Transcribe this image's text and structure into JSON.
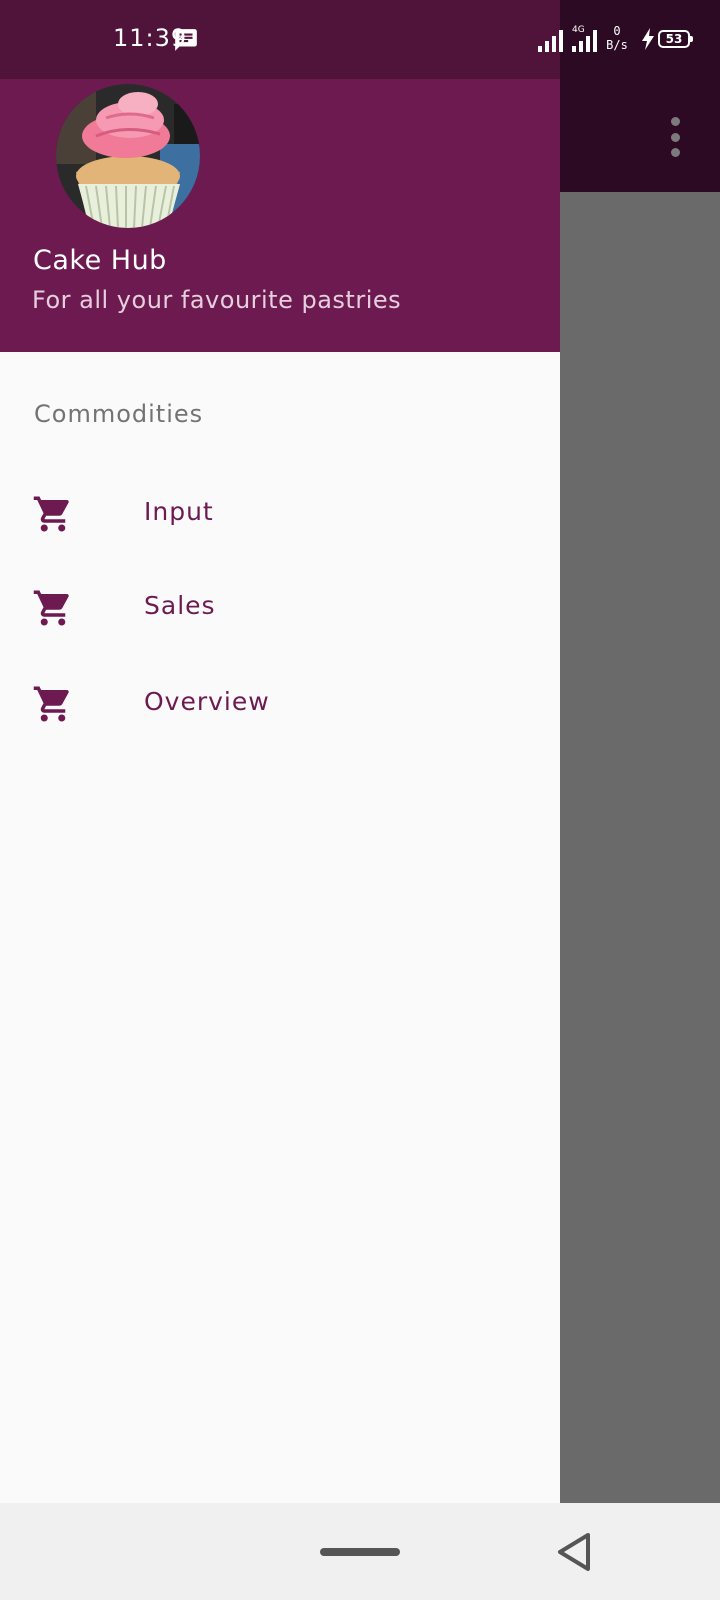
{
  "status_bar": {
    "time": "11:39",
    "net_speed_value": "0",
    "net_speed_unit": "B/s",
    "network_type": "4G",
    "battery": "53",
    "icons": [
      "message-icon",
      "signal-icon",
      "signal-4g-icon",
      "charging-icon",
      "battery-icon"
    ]
  },
  "drawer": {
    "header": {
      "app_name": "Cake Hub",
      "tagline": "For all your favourite pastries",
      "avatar": "cupcake-photo"
    },
    "section_label": "Commodities",
    "items": [
      {
        "label": "Input",
        "icon": "cart-icon"
      },
      {
        "label": "Sales",
        "icon": "cart-icon"
      },
      {
        "label": "Overview",
        "icon": "cart-icon"
      }
    ]
  },
  "toolbar": {
    "overflow_icon": "more-vert-icon"
  },
  "colors": {
    "primary": "#6d1a51",
    "primary_dark": "#50133a",
    "scrim": "#6a6a6a",
    "drawer_bg": "#fafafa",
    "section_label": "#737373"
  }
}
